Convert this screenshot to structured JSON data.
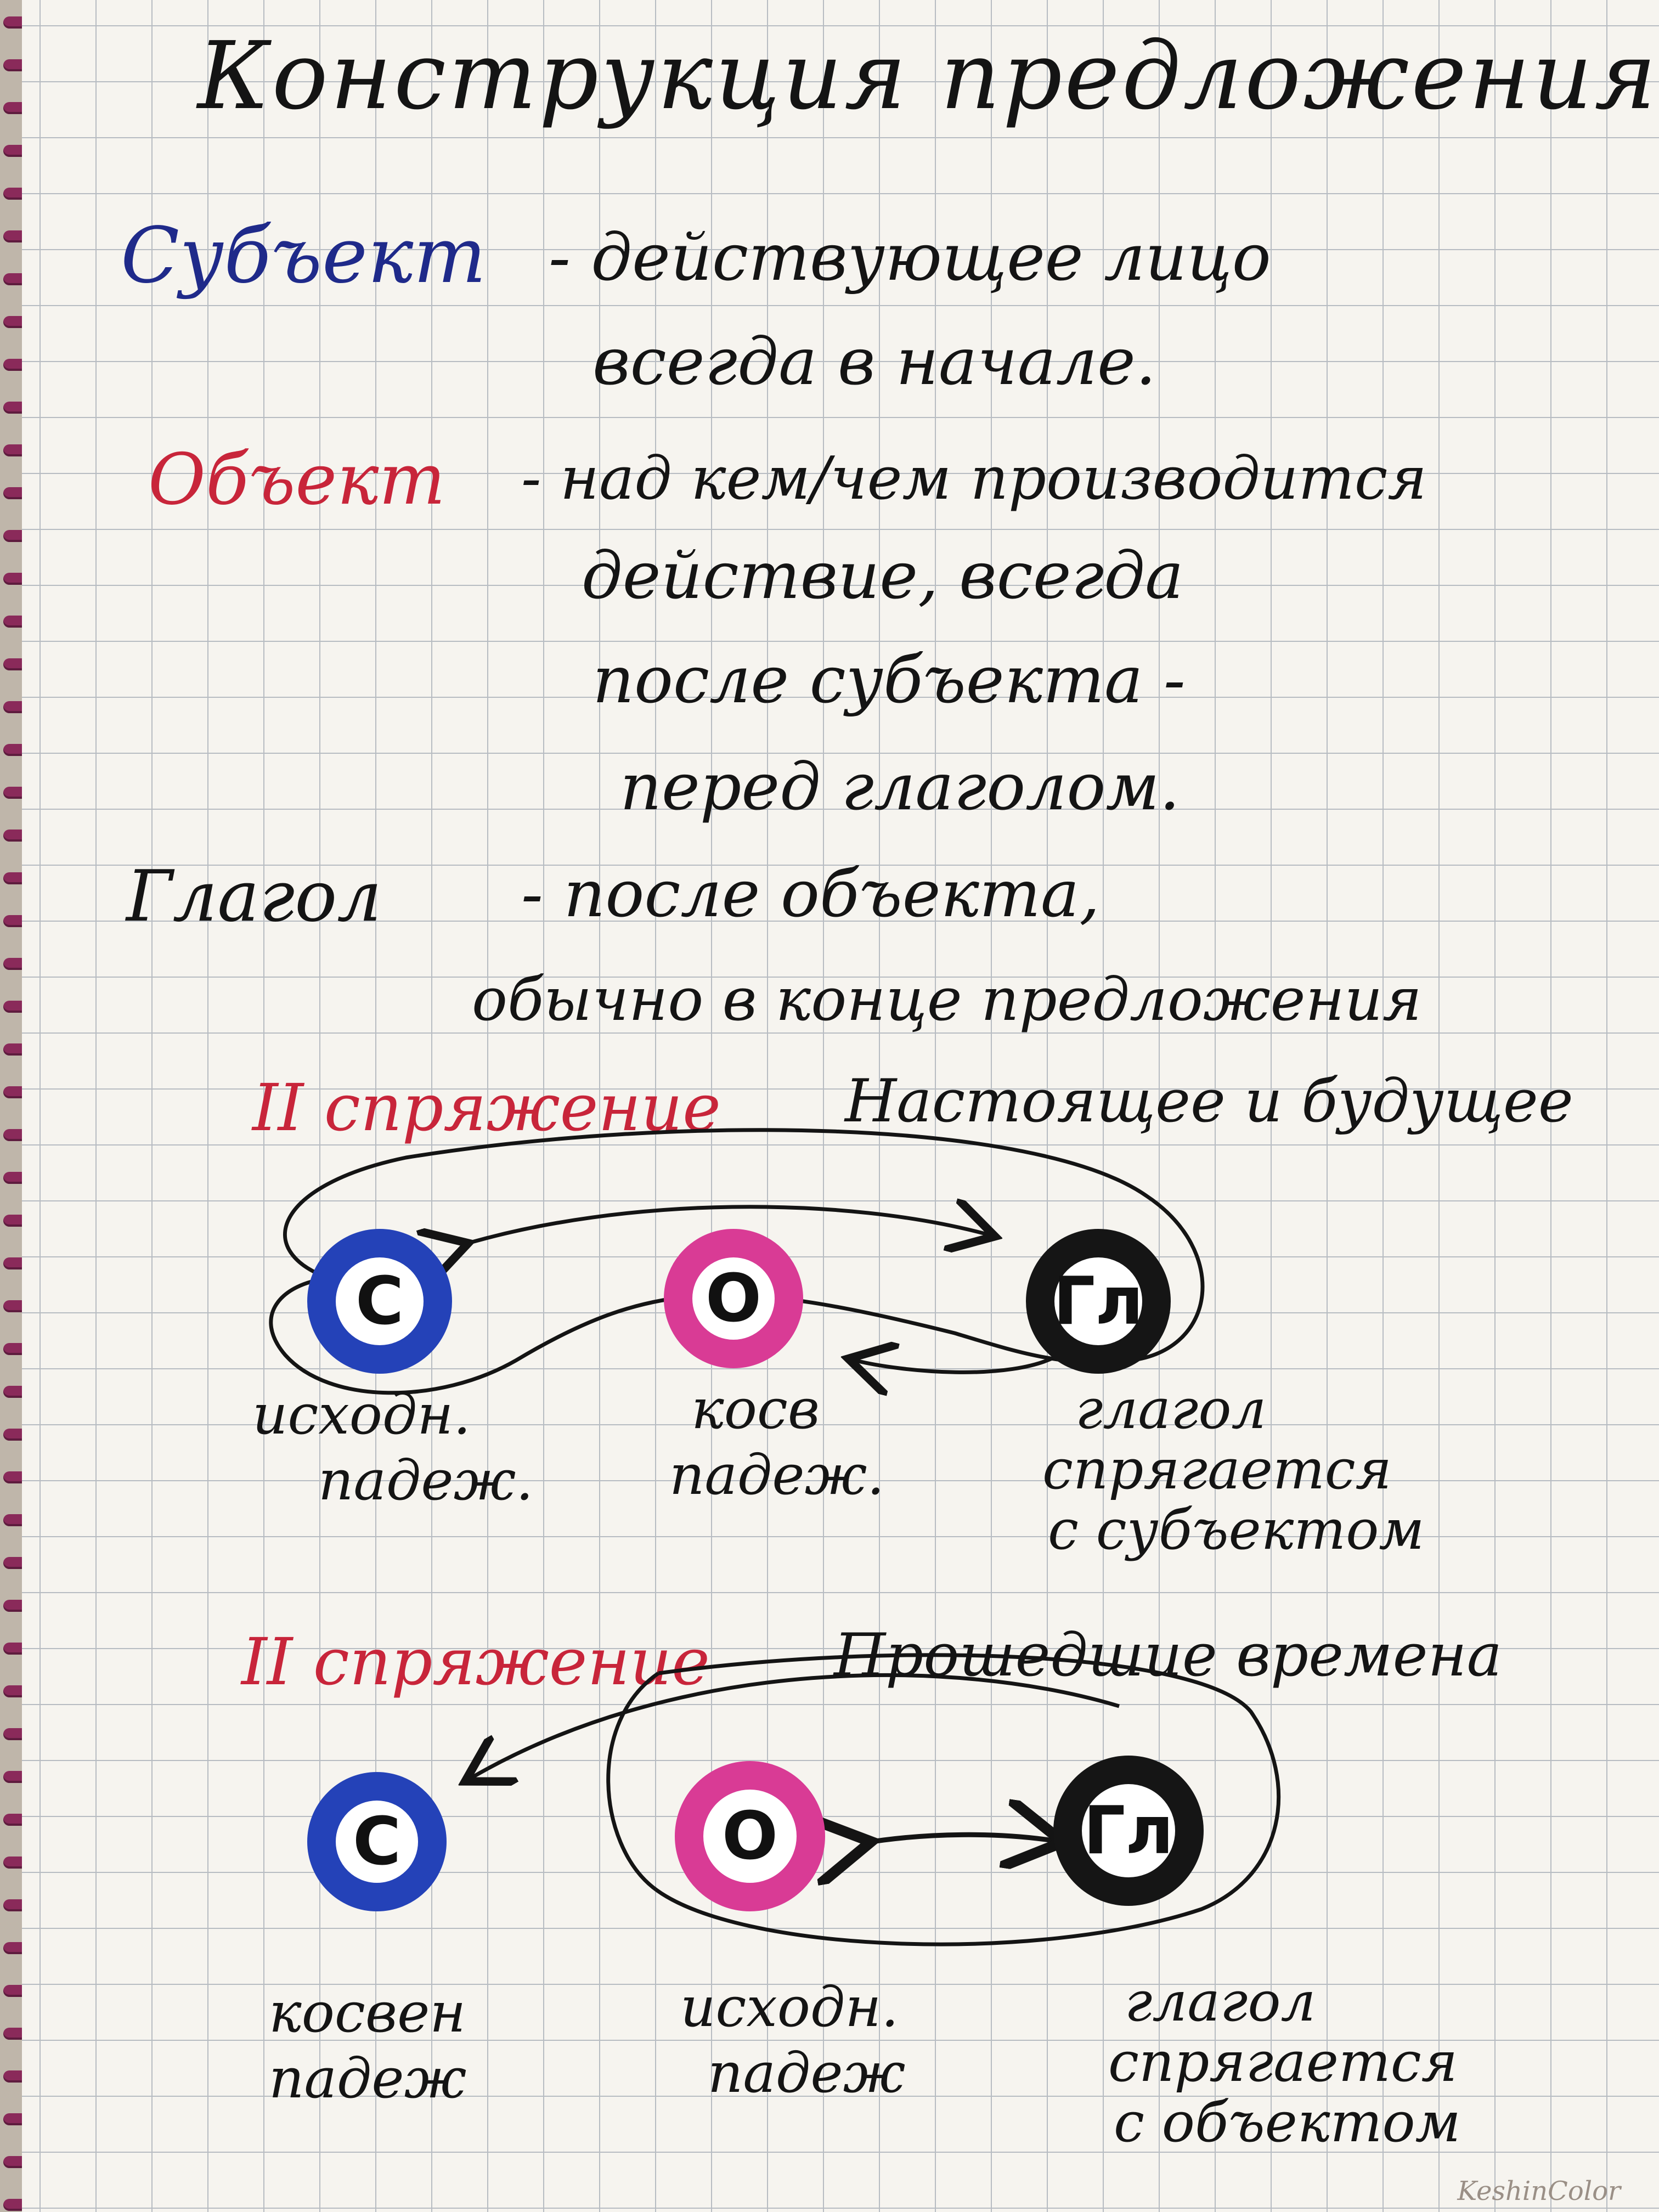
{
  "title": "Конструкция предложения",
  "definitions": [
    {
      "term": "Субъект",
      "lines": [
        "- действующее лицо",
        "всегда в начале."
      ]
    },
    {
      "term": "Объект",
      "lines": [
        "- над кем/чем производится",
        "действие, всегда",
        "после субъекта -",
        "перед глаголом."
      ]
    },
    {
      "term": "Глагол",
      "lines": [
        "- после объекта,",
        "обычно в конце предложения"
      ]
    }
  ],
  "diagrams": [
    {
      "heading_label": "II спряжение",
      "heading_text": "Настоящее и будущее",
      "nodes": [
        "С",
        "О",
        "Гл"
      ],
      "captions": [
        {
          "lines": [
            "исходн.",
            "падеж."
          ]
        },
        {
          "lines": [
            "косв",
            "падеж."
          ]
        },
        {
          "lines": [
            "глагол",
            "спрягается",
            "с субъектом"
          ]
        }
      ]
    },
    {
      "heading_label": "II спряжение",
      "heading_text": "Прошедшие времена",
      "nodes": [
        "С",
        "О",
        "Гл"
      ],
      "captions": [
        {
          "lines": [
            "косвен",
            "падеж"
          ]
        },
        {
          "lines": [
            "исходн.",
            "падеж"
          ]
        },
        {
          "lines": [
            "глагол",
            "спрягается",
            "с объектом"
          ]
        }
      ]
    }
  ],
  "watermark": "KeshinColor",
  "colors": {
    "subject": "#1f2a8a",
    "object": "#c8253a",
    "verb": "#141414",
    "node_subject": "#2442b8",
    "node_object": "#d93b95",
    "node_verb": "#151515",
    "paper": "#f6f4ef",
    "grid": "#b7bcc2"
  }
}
